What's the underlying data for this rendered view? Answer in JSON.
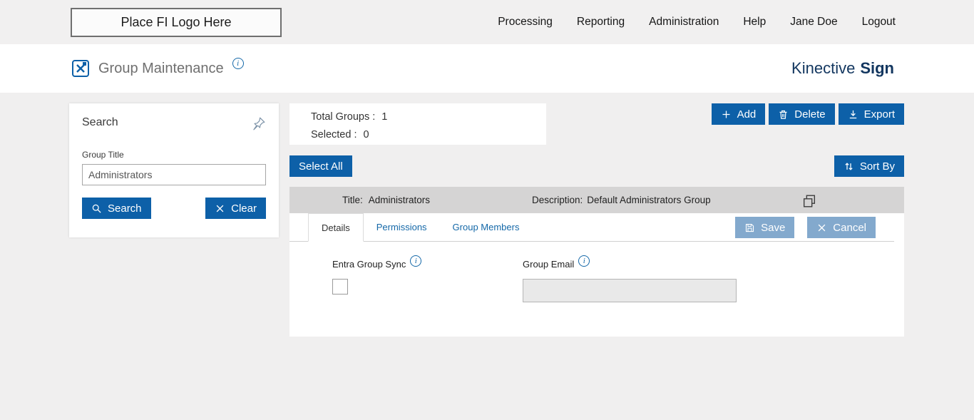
{
  "header": {
    "logo_placeholder": "Place FI Logo Here",
    "nav": [
      "Processing",
      "Reporting",
      "Administration",
      "Help",
      "Jane Doe",
      "Logout"
    ]
  },
  "page": {
    "title": "Group Maintenance",
    "brand_first": "Kinective",
    "brand_second": "Sign"
  },
  "icons": {
    "info": "i"
  },
  "search_panel": {
    "heading": "Search",
    "group_title_label": "Group Title",
    "group_title_value": "Administrators",
    "search_button": "Search",
    "clear_button": "Clear"
  },
  "summary": {
    "total_groups_label": "Total Groups :",
    "total_groups_value": "1",
    "selected_label": "Selected :",
    "selected_value": "0"
  },
  "toolbar": {
    "add": "Add",
    "delete": "Delete",
    "export": "Export",
    "select_all": "Select All",
    "sort_by": "Sort By"
  },
  "group_row": {
    "title_label": "Title:",
    "title_value": "Administrators",
    "description_label": "Description:",
    "description_value": "Default Administrators Group"
  },
  "tabs": [
    {
      "label": "Details"
    },
    {
      "label": "Permissions"
    },
    {
      "label": "Group Members"
    }
  ],
  "panel_actions": {
    "save": "Save",
    "cancel": "Cancel"
  },
  "details_form": {
    "entra_label": "Entra Group Sync",
    "email_label": "Group Email",
    "email_value": ""
  },
  "colors": {
    "primary_blue": "#0d60a8",
    "muted_blue": "#83a9cd",
    "brand_navy": "#12365f",
    "content_bg": "#f0efef",
    "group_bar_bg": "#d5d4d4"
  }
}
